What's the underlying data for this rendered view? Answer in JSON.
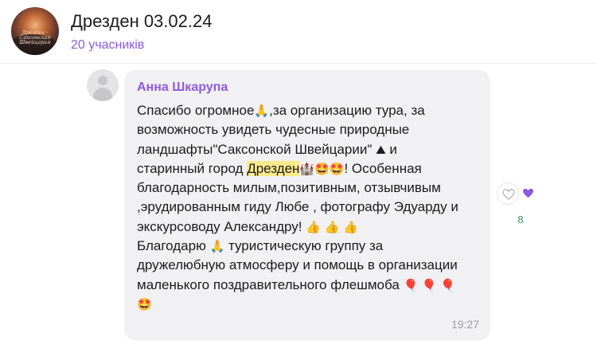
{
  "header": {
    "title": "Дрезден 03.02.24",
    "members": "20 учасників",
    "avatar_caption": "Дрезден · Саксонская Швейцария"
  },
  "message": {
    "sender": "Анна Шкарупа",
    "lines": [
      [
        "Спасибо огромное",
        "🙏",
        ",за организацию тура, за"
      ],
      [
        "возможность увидеть чудесные природные"
      ],
      [
        "ландшафты\"Саксонской Швейцарии\" ",
        "⛰",
        " и"
      ],
      [
        "старинный город ",
        "Дрезден",
        "🏰",
        "🤩",
        "🤩",
        "! Особенная"
      ],
      [
        "благодарность милым,позитивным, отзывчивым"
      ],
      [
        ",эрудированным гиду Любе , фотографу Эдуарду и"
      ],
      [
        "экскурсоводу Александру! ",
        "👍",
        " ",
        "👍",
        " ",
        "👍"
      ],
      [
        "Благодарю ",
        "🙏",
        " туристическую группу за"
      ],
      [
        "дружелюбную атмосферу и помощь в организации"
      ],
      [
        "маленького поздравительного флешмоба ",
        "🎈",
        " ",
        "🎈",
        " ",
        "🎈"
      ],
      [
        "🤩"
      ]
    ],
    "highlight": "Дрезден",
    "time": "19:27"
  },
  "reactions": {
    "like_icon": "heart-outline-icon",
    "reaction_icon": "purple-heart-icon",
    "count": "8",
    "accent_color": "#8e5bdb"
  }
}
